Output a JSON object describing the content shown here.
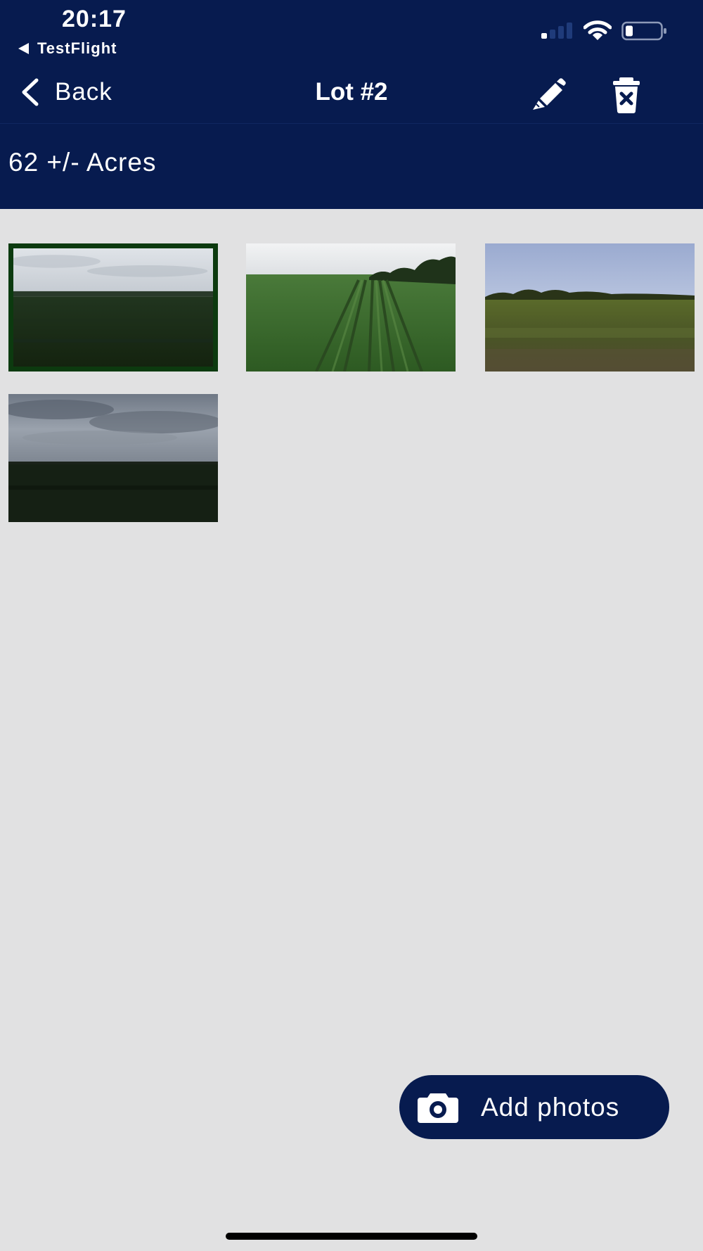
{
  "status_bar": {
    "time": "20:17",
    "back_app": "TestFlight",
    "icons": [
      "signal-icon",
      "wifi-icon",
      "battery-icon"
    ]
  },
  "nav": {
    "back_label": "Back",
    "title": "Lot #2",
    "actions": [
      "pencil-icon",
      "trash-icon"
    ]
  },
  "lot": {
    "acreage": "62 +/- Acres"
  },
  "photos": [
    {
      "scene": "field with overcast sky",
      "selected": true
    },
    {
      "scene": "green crop rows with tree line",
      "selected": false
    },
    {
      "scene": "grassland with blue sky",
      "selected": false
    },
    {
      "scene": "dark field under storm clouds",
      "selected": false
    }
  ],
  "actions": {
    "add_photos_label": "Add photos",
    "add_photos_icon": "camera-icon"
  },
  "colors": {
    "brand_navy": "#071b4f",
    "background": "#e1e1e2",
    "selected_border": "#0c3a0f"
  }
}
